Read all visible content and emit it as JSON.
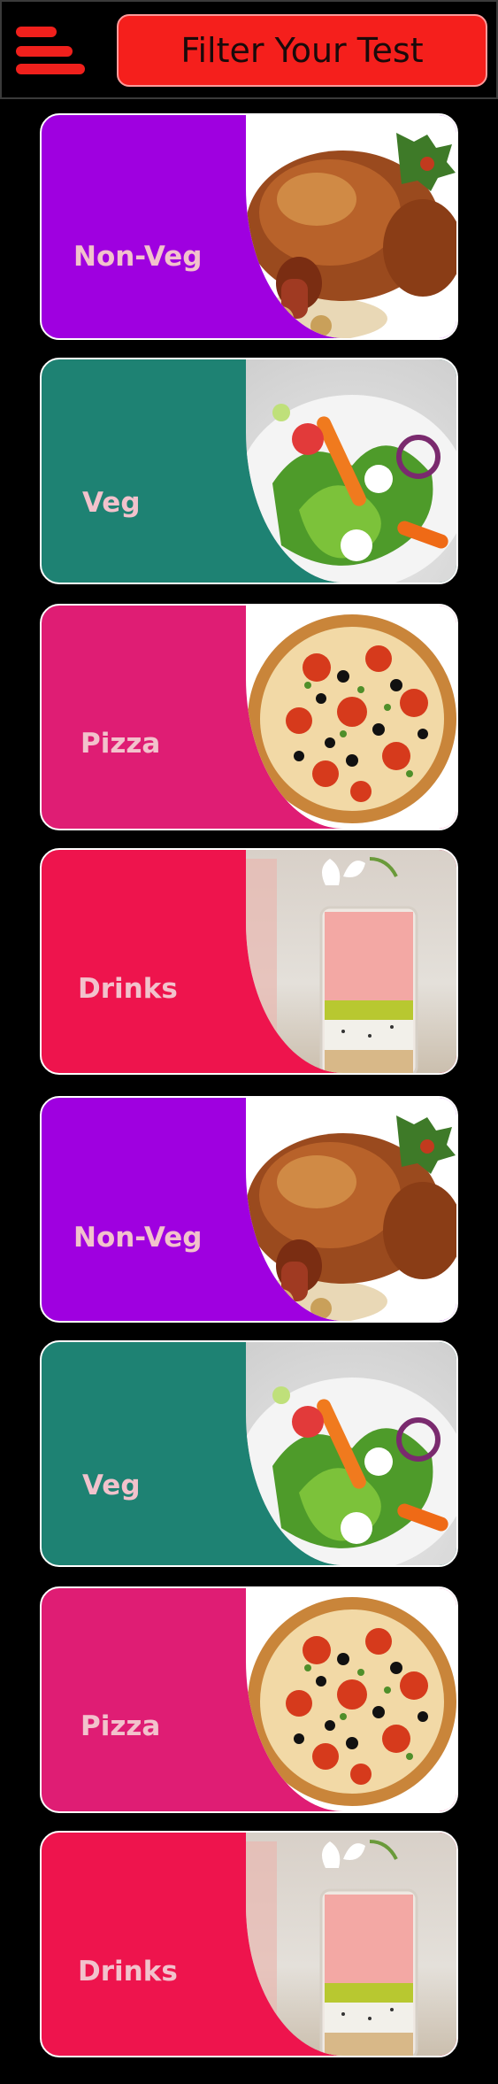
{
  "header": {
    "filter_label": "Filter Your Test"
  },
  "categories": [
    {
      "label": "Non-Veg",
      "color": "#9f00e0",
      "food_icon": "roast-chicken-image"
    },
    {
      "label": "Veg",
      "color": "#1e8273",
      "food_icon": "salad-image"
    },
    {
      "label": "Pizza",
      "color": "#df1d74",
      "food_icon": "pizza-image"
    },
    {
      "label": "Drinks",
      "color": "#ee144d",
      "food_icon": "smoothie-image"
    },
    {
      "label": "Non-Veg",
      "color": "#9f00e0",
      "food_icon": "roast-chicken-image"
    },
    {
      "label": "Veg",
      "color": "#1e8273",
      "food_icon": "salad-image"
    },
    {
      "label": "Pizza",
      "color": "#df1d74",
      "food_icon": "pizza-image"
    },
    {
      "label": "Drinks",
      "color": "#ee144d",
      "food_icon": "smoothie-image"
    }
  ]
}
